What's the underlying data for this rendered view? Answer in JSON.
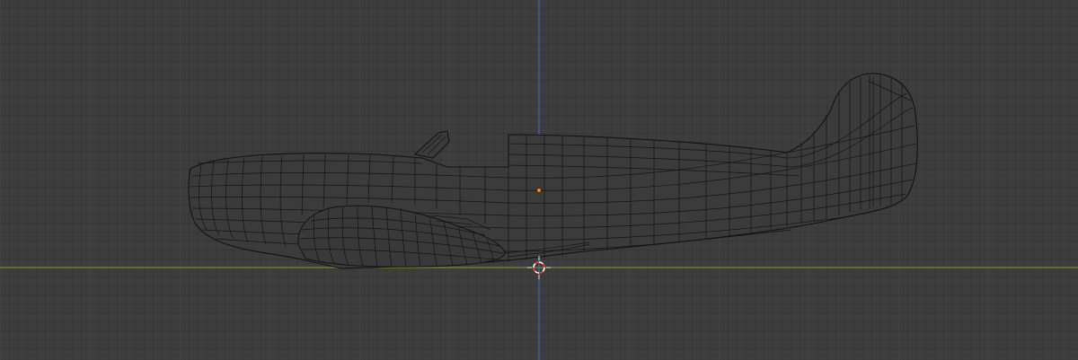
{
  "viewport": {
    "background_color": "#3d3d3d",
    "grid_color": "#4a4a4a",
    "x_axis_color": "#6d8f2d",
    "z_axis_color": "#3a6fa8",
    "origin_color": "#ff8a1a",
    "cursor_color_primary": "#ff3b3b",
    "cursor_color_secondary": "#ffffff"
  },
  "object": {
    "type": "mesh",
    "description_icon": "airplane-fuselage-wireframe",
    "display_mode": "wireframe"
  },
  "icons": {
    "cursor": "3d-cursor-icon",
    "origin": "object-origin-icon"
  }
}
